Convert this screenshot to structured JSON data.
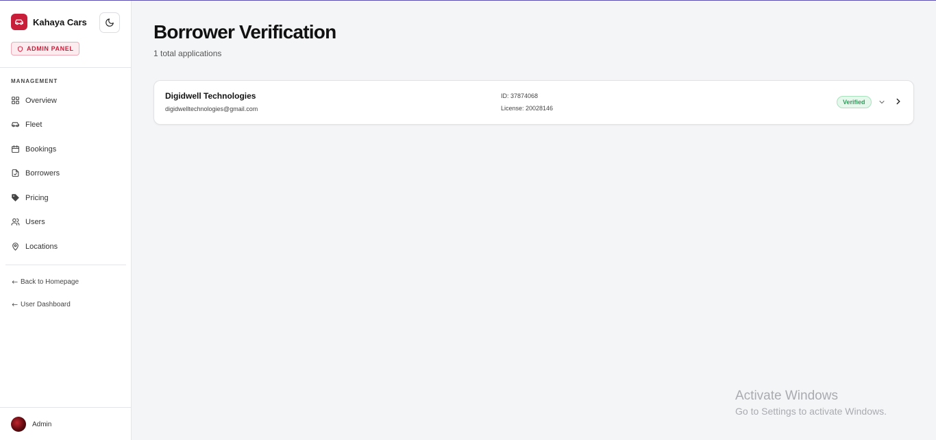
{
  "brand": {
    "name": "Kahaya Cars",
    "accent": "#c81e3a"
  },
  "admin_badge": "ADMIN PANEL",
  "sidebar": {
    "section_label": "MANAGEMENT",
    "items": [
      {
        "label": "Overview",
        "icon": "grid-icon"
      },
      {
        "label": "Fleet",
        "icon": "car-icon"
      },
      {
        "label": "Bookings",
        "icon": "calendar-icon"
      },
      {
        "label": "Borrowers",
        "icon": "file-check-icon"
      },
      {
        "label": "Pricing",
        "icon": "tag-icon"
      },
      {
        "label": "Users",
        "icon": "users-icon"
      },
      {
        "label": "Locations",
        "icon": "map-pin-icon"
      }
    ],
    "links": [
      {
        "label": "Back to Homepage"
      },
      {
        "label": "User Dashboard"
      }
    ],
    "user": {
      "name": "Admin"
    }
  },
  "page": {
    "title": "Borrower Verification",
    "subtitle": "1 total applications"
  },
  "applications": [
    {
      "name": "Digidwell Technologies",
      "email": "digidwelltechnologies@gmail.com",
      "id": "ID: 37874068",
      "license": "License: 20028146",
      "status": "Verified",
      "status_color": "#2f9e5b"
    }
  ],
  "watermark": {
    "title": "Activate Windows",
    "subtitle": "Go to Settings to activate Windows."
  }
}
